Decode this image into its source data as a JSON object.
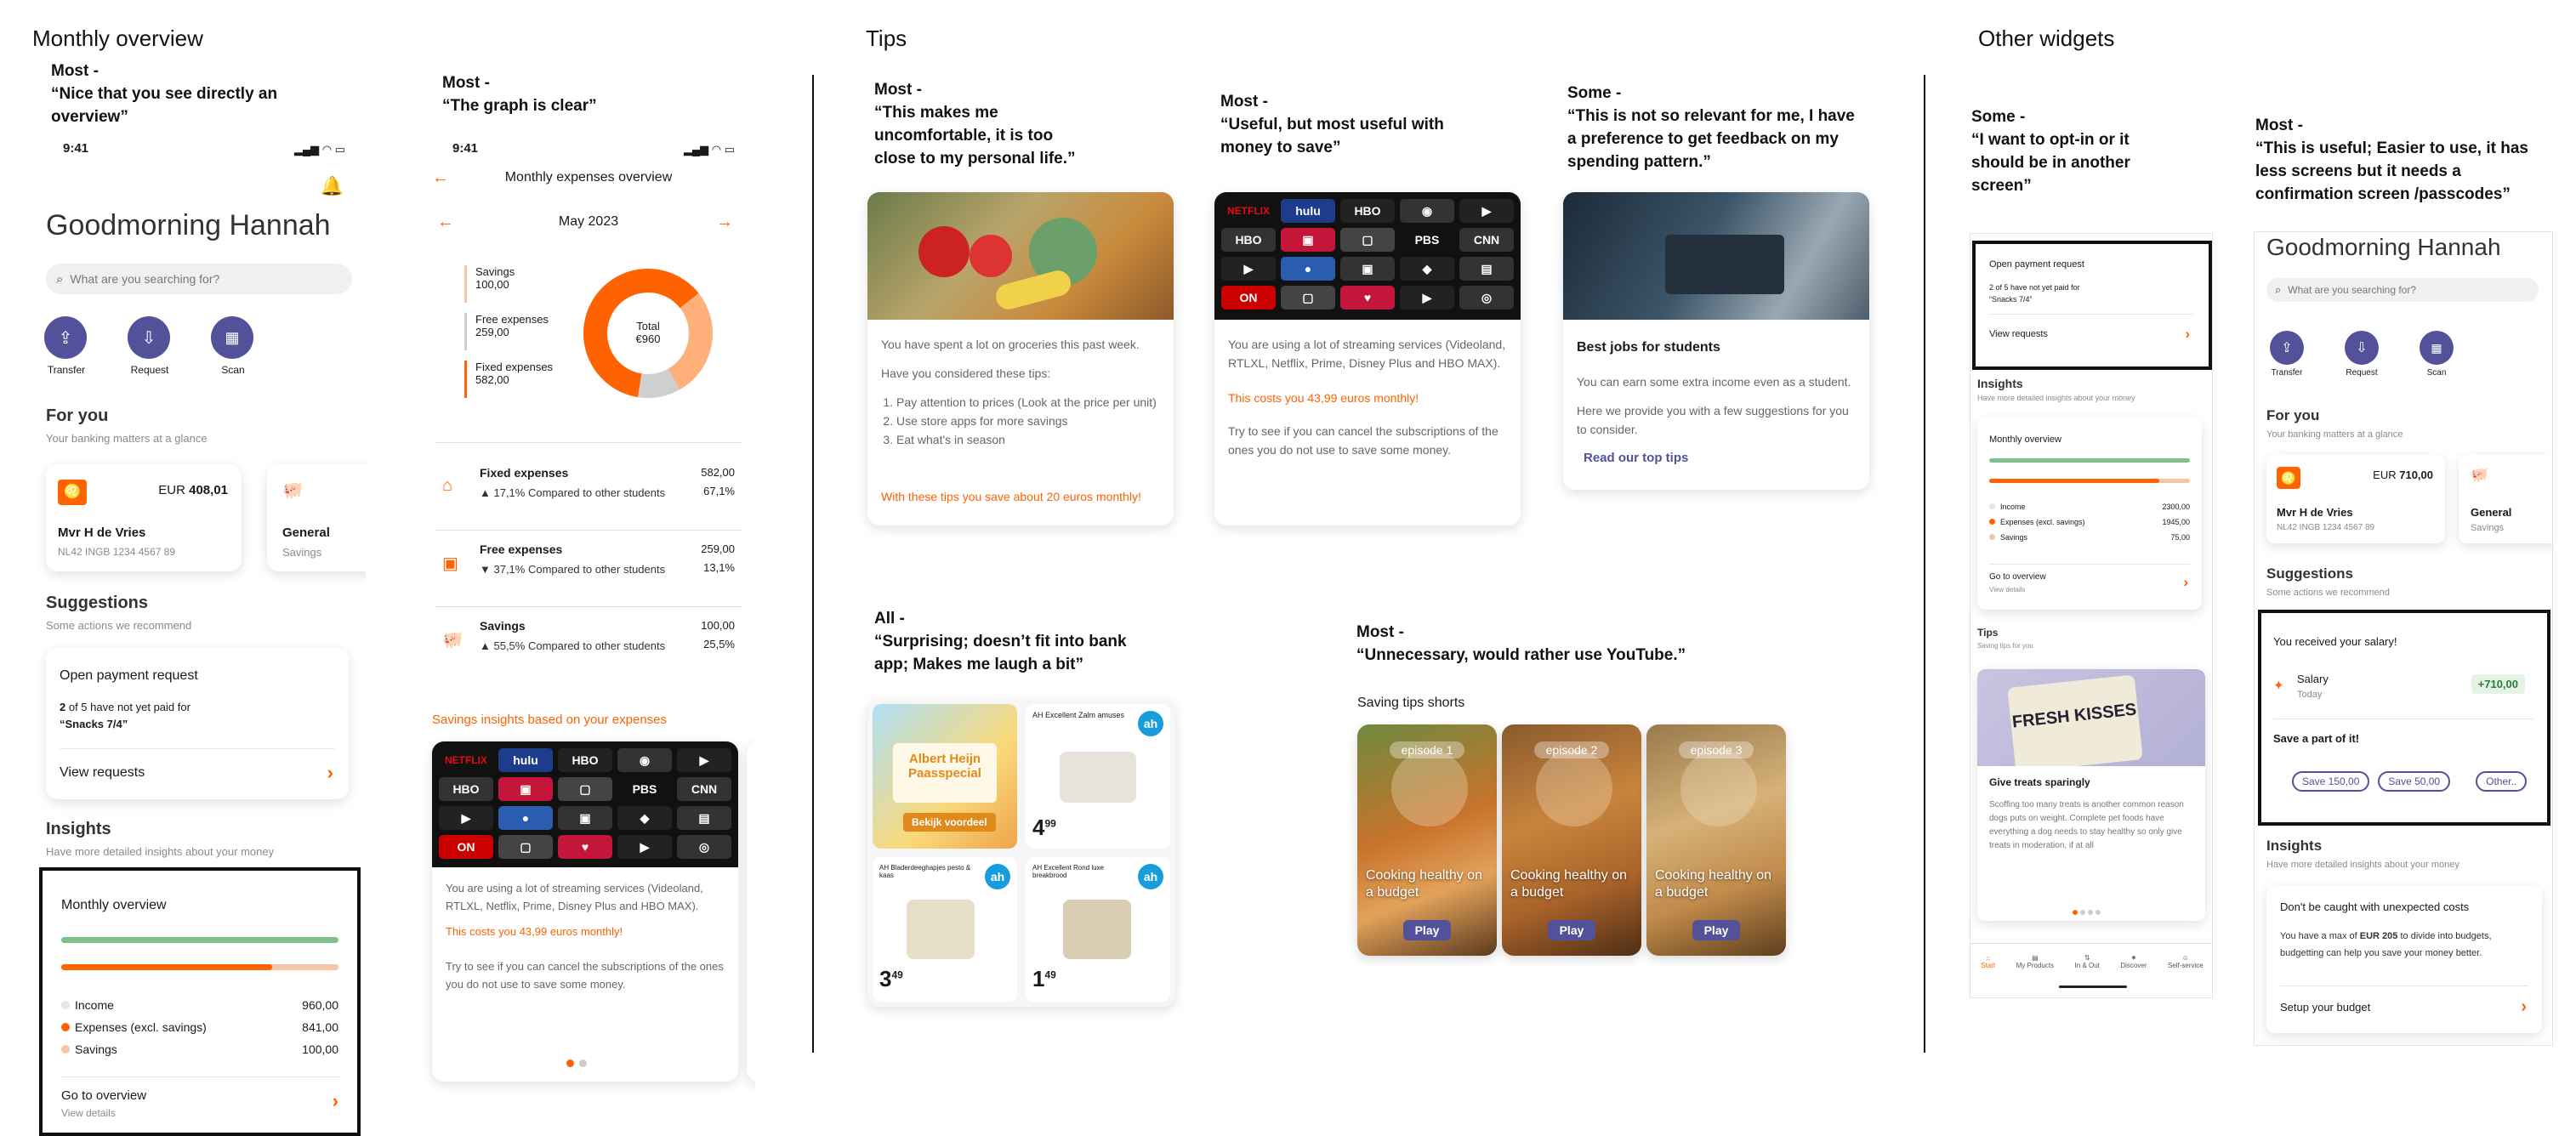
{
  "sections": {
    "monthly": "Monthly overview",
    "tips": "Tips",
    "other": "Other widgets"
  },
  "quotes": {
    "q1": "Most -\n“Nice that you see directly an\noverview”",
    "q2": "Most -\n“The graph is clear”",
    "q3": "Most -\n“This makes me\nuncomfortable, it is too\nclose to my personal life.”",
    "q4": "Most -\n“Useful, but most useful with\nmoney to save”",
    "q5": "Some -\n“This is not so relevant for me, I have\na preference to get feedback on my\nspending pattern.”",
    "q6": "All -\n“Surprising; doesn’t fit into bank\napp; Makes me laugh a bit”",
    "q7": "Most -\n“Unnecessary, would rather use YouTube.”",
    "q8": "Some -\n“I want to opt-in or it\nshould be in another\nscreen”",
    "q9": "Most -\n“This is useful; Easier to use, it has\nless screens but it needs a\nconfirmation screen /passcodes”"
  },
  "home": {
    "time": "9:41",
    "greeting": "Goodmorning Hannah",
    "search_placeholder": "What are you searching for?",
    "actions": [
      "Transfer",
      "Request",
      "Scan"
    ],
    "for_you": "For you",
    "for_you_sub": "Your banking matters at a glance",
    "account_currency": "EUR",
    "account_balance": "408,01",
    "account_name": "Mvr H de Vries",
    "account_iban": "NL42 INGB 1234 4567 89",
    "savings_title": "General",
    "savings_sub": "Savings",
    "suggestions": "Suggestions",
    "suggestions_sub": "Some actions we recommend",
    "payment_title": "Open payment request",
    "payment_count_a": "2",
    "payment_count_b": " of 5 have not yet paid for",
    "payment_for": "“Snacks 7/4”",
    "view_requests": "View requests",
    "insights": "Insights",
    "insights_sub": "Have more detailed insights about your money",
    "mo_title": "Monthly overview",
    "mo_income_label": "Income",
    "mo_income": "960,00",
    "mo_exp_label": "Expenses (excl. savings)",
    "mo_exp": "841,00",
    "mo_sav_label": "Savings",
    "mo_sav": "100,00",
    "go_overview": "Go to overview",
    "view_details": "View details"
  },
  "expenses": {
    "time": "9:41",
    "title": "Monthly expenses overview",
    "month": "May 2023",
    "legend": [
      {
        "label": "Savings",
        "value": "100,00"
      },
      {
        "label": "Free expenses",
        "value": "259,00"
      },
      {
        "label": "Fixed expenses",
        "value": "582,00"
      }
    ],
    "donut_label": "Total",
    "donut_value": "€960",
    "rows": [
      {
        "title": "Fixed expenses",
        "amount": "582,00",
        "change": "▲ 17,1% Compared to other students",
        "pct": "67,1%"
      },
      {
        "title": "Free expenses",
        "amount": "259,00",
        "change": "▼ 37,1% Compared to other students",
        "pct": "13,1%"
      },
      {
        "title": "Savings",
        "amount": "100,00",
        "change": "▲ 55,5% Compared to other students",
        "pct": "25,5%"
      }
    ],
    "insights_title": "Savings insights based on your expenses",
    "card_text": "You are using a lot of streaming services (Videoland, RTLXL, Netflix, Prime, Disney Plus and HBO MAX).",
    "card_cost": "This costs you 43,99 euros monthly!",
    "card_tip": "Try to see if you can cancel the subscriptions of the ones you do not use to save some money."
  },
  "chart_data": {
    "type": "pie",
    "categories": [
      "Savings",
      "Free expenses",
      "Fixed expenses"
    ],
    "values": [
      100,
      259,
      582
    ],
    "colors": [
      "#cfcfcf",
      "#ffb07a",
      "#ff6200"
    ],
    "title": "Total €960"
  },
  "tip1": {
    "line1": "You have spent a lot on groceries this past week.",
    "line2": "Have you considered these tips:",
    "items": [
      "Pay attention to prices (Look at the price per unit)",
      "Use store apps for more savings",
      "Eat what's in season"
    ],
    "footer": "With these tips you save about 20 euros monthly!"
  },
  "tip2": {
    "text": "You are using a lot of streaming services (Videoland, RTLXL, Netflix, Prime, Disney Plus and HBO MAX).",
    "cost": "This costs you 43,99 euros monthly!",
    "tip": "Try to see if you can cancel the subscriptions of the ones you do not use to save some money."
  },
  "tip3": {
    "title": "Best jobs for students",
    "line1": "You can earn some extra income even as a student.",
    "line2": "Here we provide you with a few suggestions for you to consider.",
    "link": "Read our top tips"
  },
  "ah": {
    "banner_l1": "Albert Heijn",
    "banner_l2": "Paasspecial",
    "banner_btn": "Bekijk voordeel",
    "p1_title": "AH Excellent Zalm amuses",
    "p1_price_int": "4",
    "p1_price_dec": "99",
    "p2_title": "AH Bladerdeeghapjes pesto & kaas",
    "p2_price_int": "3",
    "p2_price_dec": "49",
    "p3_title": "AH Excellent Rond luxe breakbrood",
    "p3_price_int": "1",
    "p3_price_dec": "49"
  },
  "shorts": {
    "title": "Saving tips shorts",
    "items": [
      {
        "ep": "episode 1",
        "caption": "Cooking healthy on a budget",
        "play": "Play"
      },
      {
        "ep": "episode 2",
        "caption": "Cooking healthy on a budget",
        "play": "Play"
      },
      {
        "ep": "episode 3",
        "caption": "Cooking healthy on a budget",
        "play": "Play"
      }
    ]
  },
  "w1": {
    "payment_title": "Open payment request",
    "payment_line": "2 of 5 have not yet paid for",
    "payment_for": "“Snacks 7/4”",
    "view_requests": "View requests",
    "insights": "Insights",
    "insights_sub": "Have more detailed insights about your money",
    "mo_title": "Monthly overview",
    "income_label": "Income",
    "income": "2300,00",
    "exp_label": "Expenses (excl. savings)",
    "exp": "1945,00",
    "sav_label": "Savings",
    "sav": "75,00",
    "go_overview": "Go to overview",
    "view_details": "View details",
    "tips": "Tips",
    "tips_sub": "Saving tips for you",
    "treat_brand": "FRESH KISSES",
    "treat_title": "Give treats sparingly",
    "treat_text": "Scoffing too many treats is another common reason dogs puts on weight. Complete pet foods have everything a dog needs to stay healthy so only give treats in moderation, if at all",
    "nav": [
      "Start",
      "My Products",
      "In & Out",
      "Discover",
      "Self-service"
    ]
  },
  "w2": {
    "greeting": "Goodmorning Hannah",
    "search_placeholder": "What are you searching for?",
    "actions": [
      "Transfer",
      "Request",
      "Scan"
    ],
    "for_you": "For you",
    "for_you_sub": "Your banking matters at a glance",
    "currency": "EUR",
    "balance": "710,00",
    "name": "Mvr H de Vries",
    "iban": "NL42 INGB 1234 4567 89",
    "savings_title": "General",
    "savings_sub": "Savings",
    "suggestions": "Suggestions",
    "suggestions_sub": "Some actions we recommend",
    "salary_title": "You received your salary!",
    "salary_label": "Salary",
    "salary_when": "Today",
    "salary_amount": "+710,00",
    "save_part": "Save a part of it!",
    "save_btns": [
      "Save 150,00",
      "Save 50,00",
      "Other.."
    ],
    "insights": "Insights",
    "insights_sub": "Have more detailed insights about your money",
    "budget_title": "Don't be caught with unexpected costs",
    "budget_pre": "You have a max of ",
    "budget_amount": "EUR 205",
    "budget_post": " to divide into budgets, budgetting can help you save your money better.",
    "setup_budget": "Setup your budget"
  },
  "colors": {
    "orange": "#ff6200",
    "purple": "#525199",
    "green": "#7fbf8e"
  }
}
